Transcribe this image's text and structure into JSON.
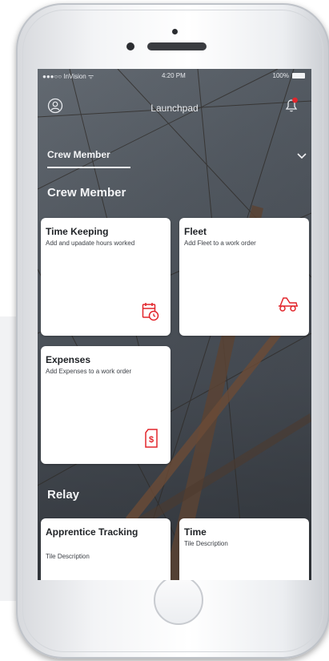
{
  "status_bar": {
    "carrier": "●●●○○ InVision ᯤ",
    "time": "4:20 PM",
    "battery": "100%"
  },
  "header": {
    "title": "Launchpad",
    "left_icon": "user-icon",
    "right_icon": "bell-notification-icon"
  },
  "selector": {
    "selected": "Crew Member",
    "icon": "chevron-down-icon"
  },
  "sections": {
    "crew": {
      "title": "Crew Member"
    },
    "relay": {
      "title": "Relay"
    }
  },
  "tiles": [
    {
      "title": "Time Keeping",
      "description": "Add and upadate hours worked",
      "icon": "calendar-clock-icon"
    },
    {
      "title": "Fleet",
      "description": "Add Fleet to a work order",
      "icon": "vehicle-icon"
    },
    {
      "title": "Expenses",
      "description": "Add Expenses to a work order",
      "icon": "receipt-dollar-icon"
    },
    {
      "title": "Apprentice Tracking",
      "description": "Tile Description"
    },
    {
      "title": "Time",
      "description": "Tile Description"
    }
  ],
  "colors": {
    "accent": "#e2252b",
    "tile_background": "#ffffff",
    "screen_overlay": "#5c636b"
  }
}
